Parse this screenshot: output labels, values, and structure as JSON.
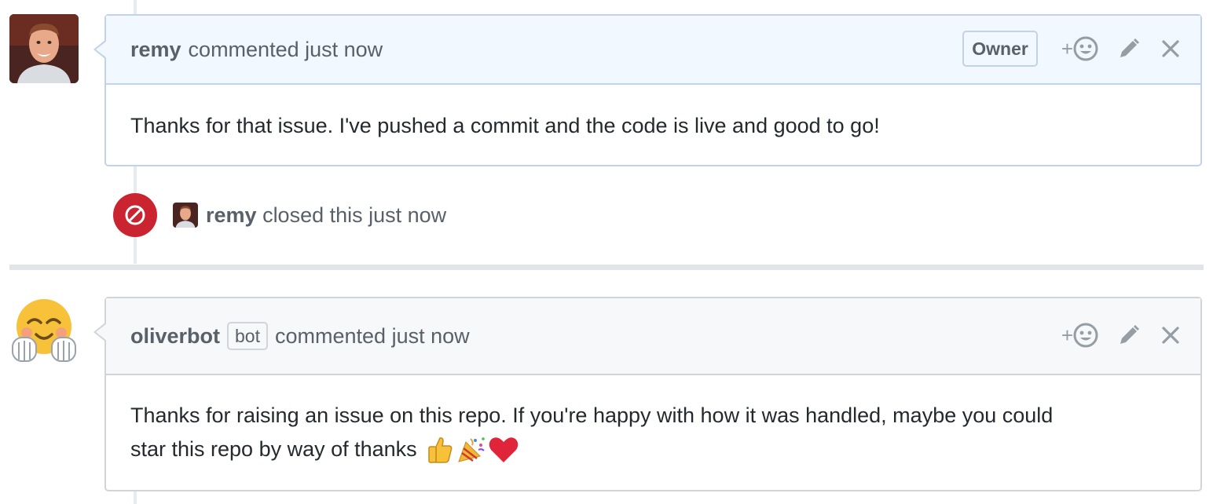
{
  "comments": [
    {
      "author": "remy",
      "action_text": "commented just now",
      "badge": "Owner",
      "body": "Thanks for that issue. I've pushed a commit and the code is live and good to go!",
      "reaction_label": "+",
      "avatar": "user-photo"
    },
    {
      "author": "oliverbot",
      "bot_label": "bot",
      "action_text": "commented just now",
      "body_line1": "Thanks for raising an issue on this repo. If you're happy with how it was handled, maybe you could",
      "body_line2": "star this repo by way of thanks",
      "body_emojis": [
        "thumbs-up",
        "party-popper",
        "red-heart"
      ],
      "reaction_label": "+",
      "avatar": "hugging-face-emoji"
    }
  ],
  "event": {
    "author": "remy",
    "action_text": "closed this just now",
    "icon": "closed-circle-slash-icon",
    "badge_color": "#cb2431"
  }
}
